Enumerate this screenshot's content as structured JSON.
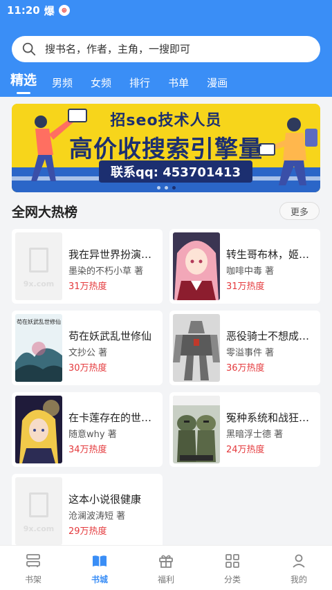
{
  "status_bar": {
    "time": "11:20",
    "icon1": "爆",
    "icon2": "⊕"
  },
  "search": {
    "placeholder": "搜书名，作者，主角，一搜即可",
    "icon": "search-icon"
  },
  "tabs": [
    {
      "label": "精选",
      "active": true
    },
    {
      "label": "男频"
    },
    {
      "label": "女频"
    },
    {
      "label": "排行"
    },
    {
      "label": "书单"
    },
    {
      "label": "漫画"
    }
  ],
  "banner": {
    "line1": "招seo技术人员",
    "line2": "高价收搜索引擎量",
    "line3": "联系qq: 453701413",
    "dots": 3,
    "active_dot": 2
  },
  "section": {
    "title": "全网大热榜",
    "more_label": "更多"
  },
  "books": [
    {
      "title": "我在异世界扮演动...",
      "author": "墨染的不朽小草 著",
      "heat": "31万热度",
      "cover": "placeholder",
      "placeholder_text": "9x.com"
    },
    {
      "title": "转生哥布林，姬骑...",
      "author": "咖啡中毒 著",
      "heat": "31万热度",
      "cover": "anime-girl"
    },
    {
      "title": "苟在妖武乱世修仙",
      "author": "文抄公 著",
      "heat": "30万热度",
      "cover": "ink-painting",
      "cover_text": "苟在妖武乱世修仙"
    },
    {
      "title": "恶役骑士不想成为...",
      "author": "零溢事件 著",
      "heat": "36万热度",
      "cover": "mecha"
    },
    {
      "title": "在卡莲存在的世界...",
      "author": "随意why 著",
      "heat": "34万热度",
      "cover": "blonde-girl"
    },
    {
      "title": "冤种系统和战狂的...",
      "author": "黑暗浮士德 著",
      "heat": "24万热度",
      "cover": "soldiers"
    },
    {
      "title": "这本小说很健康",
      "author": "沧澜波涛短 著",
      "heat": "29万热度",
      "cover": "placeholder",
      "placeholder_text": "9x.com"
    }
  ],
  "bottom_nav": [
    {
      "label": "书架",
      "icon": "bookshelf-icon"
    },
    {
      "label": "书城",
      "icon": "book-open-icon",
      "active": true
    },
    {
      "label": "福利",
      "icon": "gift-icon"
    },
    {
      "label": "分类",
      "icon": "grid-icon"
    },
    {
      "label": "我的",
      "icon": "user-icon"
    }
  ],
  "colors": {
    "brand": "#3a8ef6",
    "heat": "#e4393c",
    "banner_bg": "#f7d51b",
    "banner_text": "#1c2f70"
  }
}
